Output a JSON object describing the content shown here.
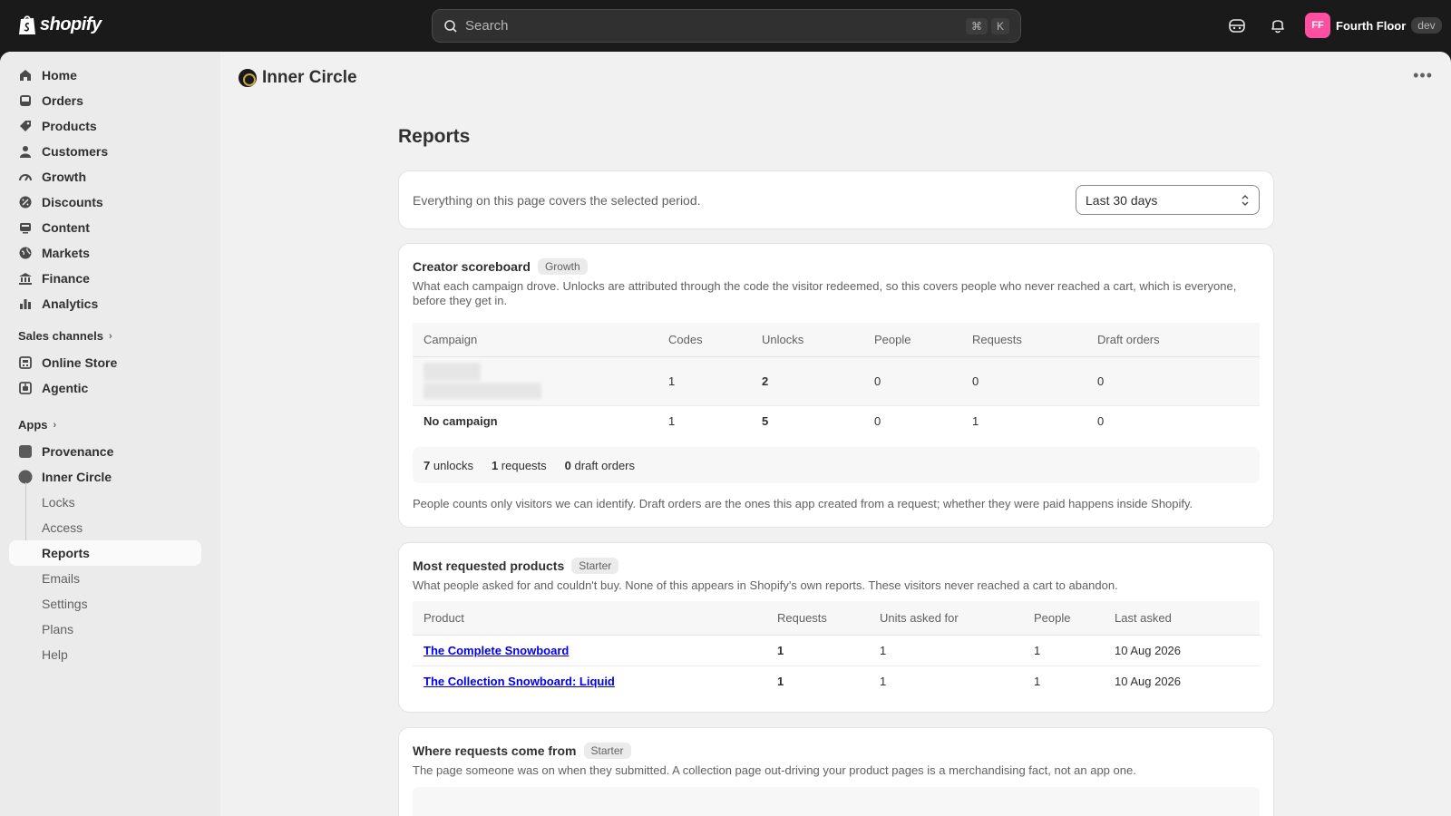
{
  "topbar": {
    "brand": "shopify",
    "search_placeholder": "Search",
    "shortcut_key1": "⌘",
    "shortcut_key2": "K",
    "account_initials": "FF",
    "account_name": "Fourth Floor",
    "account_badge": "dev"
  },
  "sidebar": {
    "items": [
      {
        "label": "Home",
        "icon": "home-icon"
      },
      {
        "label": "Orders",
        "icon": "inbox-icon"
      },
      {
        "label": "Products",
        "icon": "tag-icon"
      },
      {
        "label": "Customers",
        "icon": "person-icon"
      },
      {
        "label": "Growth",
        "icon": "gauge-icon"
      },
      {
        "label": "Discounts",
        "icon": "discount-icon"
      },
      {
        "label": "Content",
        "icon": "content-icon"
      },
      {
        "label": "Markets",
        "icon": "globe-icon"
      },
      {
        "label": "Finance",
        "icon": "bank-icon"
      },
      {
        "label": "Analytics",
        "icon": "bar-chart-icon"
      }
    ],
    "sales_channels_label": "Sales channels",
    "channels": [
      {
        "label": "Online Store",
        "icon": "store-icon"
      },
      {
        "label": "Agentic",
        "icon": "agent-icon"
      }
    ],
    "apps_label": "Apps",
    "apps": [
      {
        "label": "Provenance"
      },
      {
        "label": "Inner Circle"
      }
    ],
    "subitems": [
      "Locks",
      "Access",
      "Reports",
      "Emails",
      "Settings",
      "Plans",
      "Help"
    ]
  },
  "main": {
    "app_title": "Inner Circle",
    "more_label": "•••",
    "page_title": "Reports",
    "period": {
      "description": "Everything on this page covers the selected period.",
      "selected": "Last 30 days"
    },
    "scoreboard": {
      "title": "Creator scoreboard",
      "tag": "Growth",
      "description": "What each campaign drove. Unlocks are attributed through the code the visitor redeemed, so this covers people who never reached a cart, which is everyone, before they get in.",
      "headers": [
        "Campaign",
        "Codes",
        "Unlocks",
        "People",
        "Requests",
        "Draft orders"
      ],
      "rows": [
        {
          "campaign": "",
          "codes": "1",
          "unlocks": "2",
          "people": "0",
          "requests": "0",
          "drafts": "0"
        },
        {
          "campaign": "No campaign",
          "codes": "1",
          "unlocks": "5",
          "people": "0",
          "requests": "1",
          "drafts": "0"
        }
      ],
      "totals": {
        "unlocks_num": "7",
        "unlocks_label": "unlocks",
        "requests_num": "1",
        "requests_label": "requests",
        "drafts_num": "0",
        "drafts_label": "draft orders"
      },
      "footnote": "People counts only visitors we can identify. Draft orders are the ones this app created from a request; whether they were paid happens inside Shopify."
    },
    "requested": {
      "title": "Most requested products",
      "tag": "Starter",
      "description": "What people asked for and couldn't buy. None of this appears in Shopify's own reports. These visitors never reached a cart to abandon.",
      "headers": [
        "Product",
        "Requests",
        "Units asked for",
        "People",
        "Last asked"
      ],
      "rows": [
        {
          "product": "The Complete Snowboard",
          "requests": "1",
          "units": "1",
          "people": "1",
          "last": "10 Aug 2026"
        },
        {
          "product": "The Collection Snowboard: Liquid",
          "requests": "1",
          "units": "1",
          "people": "1",
          "last": "10 Aug 2026"
        }
      ]
    },
    "sources": {
      "title": "Where requests come from",
      "tag": "Starter",
      "description": "The page someone was on when they submitted. A collection page out-driving your product pages is a merchandising fact, not an app one."
    }
  }
}
